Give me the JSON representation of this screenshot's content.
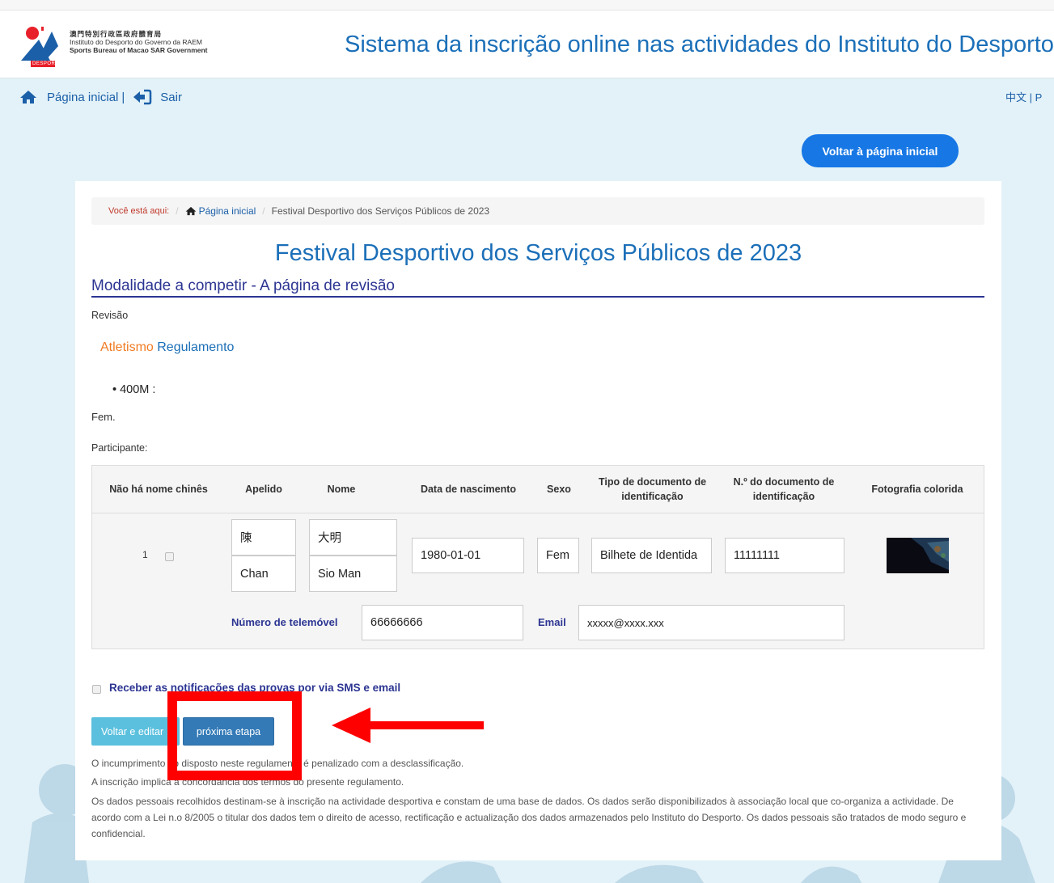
{
  "header": {
    "logo": {
      "line1": "澳門特別行政區政府體育局",
      "line2": "Instituto do Desporto do Governo da RAEM",
      "line3": "Sports Bureau of Macao SAR Government",
      "badge": "DESPORTO"
    },
    "site_title": "Sistema da inscrição online nas actividades do Instituto do Desporto"
  },
  "nav": {
    "home_label": "Página inicial",
    "separator": "|",
    "logout_label": "Sair",
    "lang_label": "中文 |  P"
  },
  "back_home_button": "Voltar à página inicial",
  "breadcrumb": {
    "prefix": "Você está aqui:",
    "separator": "/",
    "home": "Página inicial",
    "current": "Festival Desportivo dos Serviços Públicos de 2023"
  },
  "event_title": "Festival Desportivo dos Serviços Públicos de 2023",
  "section_title": "Modalidade a competir - A página de revisão",
  "review_label": "Revisão",
  "sport": {
    "name": "Atletismo",
    "rules_link": "Regulamento"
  },
  "event_item": {
    "bullet": "•",
    "name": "400M",
    "suffix": ":"
  },
  "gender_label": "Fem.",
  "participant_label": "Participante:",
  "table": {
    "headers": {
      "no_chinese_name": "Não há nome chinês",
      "surname": "Apelido",
      "name": "Nome",
      "birth_date": "Data de nascimento",
      "sex": "Sexo",
      "doc_type_l1": "Tipo de documento de",
      "doc_type_l2": "identificação",
      "doc_no_l1": "N.º do documento de",
      "doc_no_l2": "identificação",
      "photo": "Fotografia colorida"
    },
    "row": {
      "index": "1",
      "surname_chinese": "陳",
      "name_chinese": "大明",
      "surname": "Chan",
      "name": "Sio Man",
      "birth_date": "1980-01-01",
      "sex": "Fem",
      "doc_type": "Bilhete de Identida",
      "doc_no": "11111111",
      "mobile_label": "Número de telemóvel",
      "mobile": "66666666",
      "email_label": "Email",
      "email": "xxxxx@xxxx.xxx"
    }
  },
  "notify_label": "Receber as notificações das provas por via SMS e email",
  "buttons": {
    "back_edit": "Voltar e editar",
    "next": "próxima etapa"
  },
  "notes": {
    "n1": "O incumprimento do disposto neste regulamento é penalizado com a desclassificação.",
    "n2": "A inscrição implica a concordância dos termos do presente regulamento.",
    "n3": "Os dados pessoais recolhidos destinam-se à inscrição na actividade desportiva e constam de uma base de dados. Os dados serão disponibilizados à associação local que co-organiza a actividade. De acordo com a Lei n.o 8/2005 o titular dos dados tem o direito de acesso, rectificação e actualização dos dados armazenados pelo Instituto do Desporto. Os dados pessoais são tratados de modo seguro e confidencial."
  },
  "colors": {
    "title_blue": "#1b6fb8",
    "navy": "#2c3592",
    "orange": "#f07c24",
    "bg_light_blue": "#e3f2f8",
    "annotation_red": "#ff0000"
  }
}
